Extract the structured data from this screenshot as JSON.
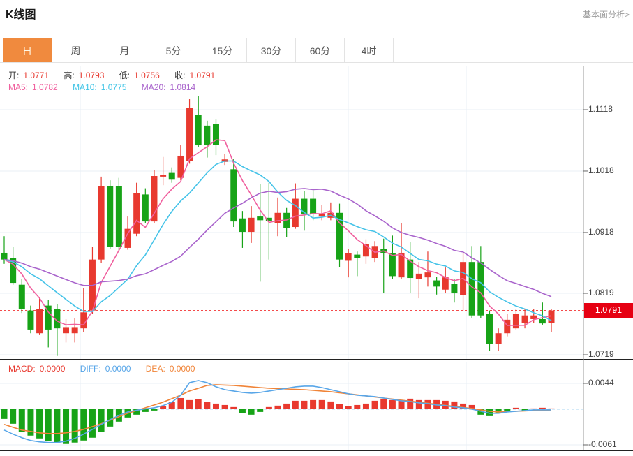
{
  "header": {
    "title": "K线图",
    "link": "基本面分析>"
  },
  "tabs": {
    "items": [
      "日",
      "周",
      "月",
      "5分",
      "15分",
      "30分",
      "60分",
      "4时"
    ],
    "active_index": 0
  },
  "ohlc_legend": {
    "open_label": "开:",
    "open": "1.0771",
    "high_label": "高:",
    "high": "1.0793",
    "low_label": "低:",
    "low": "1.0756",
    "close_label": "收:",
    "close": "1.0791"
  },
  "ma_legend": {
    "ma5_label": "MA5:",
    "ma5": "1.0782",
    "ma10_label": "MA10:",
    "ma10": "1.0775",
    "ma20_label": "MA20:",
    "ma20": "1.0814"
  },
  "macd_legend": {
    "macd_label": "MACD:",
    "macd": "0.0000",
    "diff_label": "DIFF:",
    "diff": "0.0000",
    "dea_label": "DEA:",
    "dea": "0.0000"
  },
  "colors": {
    "up": "#e8392f",
    "down": "#17a317",
    "ma5": "#f0609e",
    "ma10": "#45c3e8",
    "ma20": "#a964cc",
    "diff": "#58a6e8",
    "dea": "#f08438",
    "grid": "#e9eff5",
    "axis_line": "#999999",
    "panel_border": "#222222",
    "price_line": "#f23030",
    "zero_line": "#a8d4f0",
    "badge": "#e60012",
    "tab_active": "#f08a3e"
  },
  "chart_data": {
    "type": "candlestick",
    "title": "K线图 (日)",
    "price_axis": {
      "ticks": [
        "1.1118",
        "1.1018",
        "1.0918",
        "1.0819",
        "1.0719"
      ],
      "top_value": 1.1118,
      "bottom_value": 1.0719
    },
    "current_price": 1.0791,
    "current_price_label": "1.0791",
    "ma_periods": [
      5,
      10,
      20
    ],
    "candles": [
      [
        1.0885,
        1.0912,
        1.0867,
        1.0874
      ],
      [
        1.0876,
        1.0895,
        1.0833,
        1.0836
      ],
      [
        1.0833,
        1.0842,
        1.0787,
        1.0794
      ],
      [
        1.0791,
        1.0799,
        1.0754,
        1.076
      ],
      [
        1.0754,
        1.0813,
        1.0751,
        1.0793
      ],
      [
        1.0799,
        1.0808,
        1.0731,
        1.076
      ],
      [
        1.0794,
        1.0801,
        1.0717,
        1.0762
      ],
      [
        1.0754,
        1.0777,
        1.0739,
        1.0764
      ],
      [
        1.0754,
        1.0779,
        1.0739,
        1.0764
      ],
      [
        1.0762,
        1.0827,
        1.0756,
        1.0788
      ],
      [
        1.0791,
        1.0895,
        1.0785,
        1.0874
      ],
      [
        1.0874,
        1.1009,
        1.0869,
        1.0993
      ],
      [
        1.0993,
        1.1003,
        1.0891,
        1.0895
      ],
      [
        1.0993,
        1.1007,
        1.0887,
        1.0895
      ],
      [
        1.0893,
        1.0944,
        1.089,
        1.0924
      ],
      [
        1.0916,
        1.0999,
        1.0912,
        1.0982
      ],
      [
        1.098,
        1.099,
        1.0933,
        1.0936
      ],
      [
        1.0936,
        1.102,
        1.0933,
        1.101
      ],
      [
        1.1009,
        1.1041,
        1.0995,
        1.1012
      ],
      [
        1.1015,
        1.1024,
        1.0999,
        1.1004
      ],
      [
        1.1007,
        1.106,
        1.1003,
        1.1043
      ],
      [
        1.1034,
        1.1135,
        1.103,
        1.1121
      ],
      [
        1.1109,
        1.114,
        1.1057,
        1.106
      ],
      [
        1.1092,
        1.11,
        1.104,
        1.106
      ],
      [
        1.1095,
        1.1103,
        1.1044,
        1.1061
      ],
      [
        1.1033,
        1.1046,
        1.1028,
        1.1037
      ],
      [
        1.1021,
        1.1038,
        1.0927,
        1.0936
      ],
      [
        1.0941,
        1.0953,
        1.0893,
        1.0919
      ],
      [
        1.0919,
        1.0961,
        1.0901,
        1.0942
      ],
      [
        1.0944,
        1.0997,
        1.0838,
        1.0938
      ],
      [
        1.0942,
        1.0999,
        1.0874,
        1.0937
      ],
      [
        1.0933,
        1.0975,
        1.0912,
        1.095
      ],
      [
        1.095,
        1.0958,
        1.091,
        1.0925
      ],
      [
        1.0927,
        1.0998,
        1.0924,
        1.0973
      ],
      [
        1.0973,
        1.0986,
        1.0921,
        1.0948
      ],
      [
        1.0973,
        1.0987,
        1.0938,
        1.0948
      ],
      [
        1.0944,
        1.0963,
        1.0938,
        1.0948
      ],
      [
        1.0942,
        1.0967,
        1.0938,
        1.095
      ],
      [
        1.095,
        1.0965,
        1.0862,
        1.0874
      ],
      [
        1.0872,
        1.0891,
        1.0845,
        1.0884
      ],
      [
        1.0882,
        1.0887,
        1.0847,
        1.0876
      ],
      [
        1.0879,
        1.0907,
        1.0867,
        1.0899
      ],
      [
        1.0876,
        1.0904,
        1.087,
        1.0896
      ],
      [
        1.0891,
        1.0908,
        1.0819,
        1.0885
      ],
      [
        1.0884,
        1.0913,
        1.0842,
        1.0847
      ],
      [
        1.0845,
        1.0933,
        1.0842,
        1.0885
      ],
      [
        1.0874,
        1.0902,
        1.0819,
        1.0844
      ],
      [
        1.0842,
        1.087,
        1.0811,
        1.0851
      ],
      [
        1.0845,
        1.0887,
        1.083,
        1.0853
      ],
      [
        1.084,
        1.0846,
        1.0817,
        1.083
      ],
      [
        1.0825,
        1.0861,
        1.0819,
        1.0845
      ],
      [
        1.0834,
        1.0842,
        1.0804,
        1.0819
      ],
      [
        1.0816,
        1.0884,
        1.0791,
        1.087
      ],
      [
        1.087,
        1.0896,
        1.0779,
        1.0783
      ],
      [
        1.087,
        1.0896,
        1.0779,
        1.0783
      ],
      [
        1.0785,
        1.0791,
        1.0725,
        1.0737
      ],
      [
        1.0737,
        1.0762,
        1.0725,
        1.0754
      ],
      [
        1.0754,
        1.0785,
        1.0749,
        1.0776
      ],
      [
        1.0762,
        1.0794,
        1.076,
        1.0785
      ],
      [
        1.0771,
        1.0793,
        1.0762,
        1.0783
      ],
      [
        1.0777,
        1.0793,
        1.0771,
        1.0783
      ],
      [
        1.0777,
        1.0804,
        1.0768,
        1.077
      ],
      [
        1.0771,
        1.0793,
        1.0756,
        1.0791
      ]
    ],
    "macd": {
      "ticks": [
        "0.0044",
        "-0.0061"
      ],
      "tick_values": [
        0.0044,
        -0.0061
      ],
      "hist": [
        -0.00167,
        -0.0025,
        -0.00393,
        -0.00452,
        -0.005,
        -0.00547,
        -0.00571,
        -0.00595,
        -0.00571,
        -0.00536,
        -0.00488,
        -0.00393,
        -0.00298,
        -0.00214,
        -0.00143,
        -0.00095,
        -0.00048,
        -0.00024,
        0.00048,
        0.00119,
        0.0019,
        0.00155,
        0.00167,
        0.00119,
        0.00095,
        0.00071,
        0.00036,
        -0.00071,
        -0.00095,
        -0.00048,
        0.00036,
        0.0006,
        0.00095,
        0.00143,
        0.00143,
        0.00155,
        0.00155,
        0.00131,
        0.00083,
        0.00048,
        0.00071,
        0.00095,
        0.00143,
        0.00167,
        0.00155,
        0.00155,
        0.00179,
        0.00155,
        0.00155,
        0.00155,
        0.00143,
        0.00131,
        0.00095,
        0.00071,
        -0.00095,
        -0.00119,
        -0.0006,
        -0.00036,
        0.00024,
        -0.00024,
        0.00012,
        0.00024,
        0.00012
      ],
      "diff": [
        -0.00357,
        -0.00428,
        -0.00488,
        -0.00536,
        -0.00559,
        -0.00571,
        -0.00571,
        -0.00547,
        -0.005,
        -0.00428,
        -0.00345,
        -0.00262,
        -0.00179,
        -0.00107,
        -0.00048,
        -0.00018,
        6e-05,
        0.00024,
        0.0006,
        0.00119,
        0.00238,
        0.00452,
        0.00488,
        0.00452,
        0.00381,
        0.00333,
        0.0031,
        0.00286,
        0.00274,
        0.00286,
        0.0031,
        0.00333,
        0.00357,
        0.00381,
        0.00393,
        0.00393,
        0.00369,
        0.00333,
        0.00298,
        0.00262,
        0.00238,
        0.00226,
        0.00214,
        0.0019,
        0.00167,
        0.00143,
        0.00131,
        0.00107,
        0.00095,
        0.00071,
        0.0006,
        0.00036,
        0.00024,
        0,
        -0.00036,
        -0.00071,
        -0.00071,
        -0.00048,
        -0.00036,
        -0.00024,
        -0.00012,
        -0.00012,
        -0.00012
      ],
      "dea": [
        -0.00262,
        -0.0031,
        -0.00357,
        -0.00381,
        -0.00405,
        -0.00417,
        -0.00417,
        -0.00405,
        -0.00381,
        -0.00345,
        -0.00298,
        -0.0025,
        -0.0019,
        -0.00131,
        -0.00071,
        -0.00024,
        0.00024,
        0.00071,
        0.00119,
        0.00179,
        0.00238,
        0.0031,
        0.00357,
        0.00405,
        0.00417,
        0.00411,
        0.00405,
        0.00393,
        0.00381,
        0.00369,
        0.00357,
        0.00351,
        0.00345,
        0.00339,
        0.00333,
        0.00321,
        0.0031,
        0.00298,
        0.0028,
        0.00262,
        0.00244,
        0.00226,
        0.00208,
        0.0019,
        0.00173,
        0.00155,
        0.00137,
        0.00119,
        0.00101,
        0.00083,
        0.00065,
        0.00048,
        0.0003,
        0.00012,
        -0.00012,
        -0.00036,
        -0.00048,
        -0.00042,
        -0.00036,
        -0.0003,
        -0.00024,
        -0.00018,
        -0.00015
      ]
    }
  }
}
